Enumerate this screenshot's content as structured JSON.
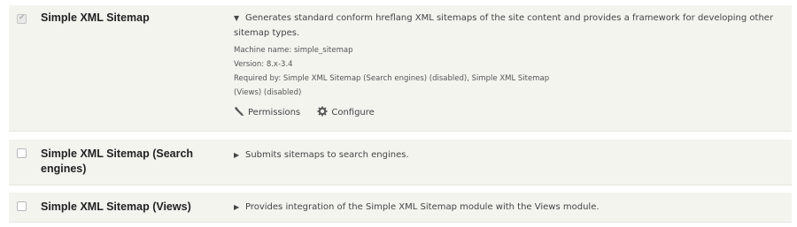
{
  "modules": [
    {
      "name": "Simple XML Sitemap",
      "checked": true,
      "expanded": true,
      "description": "Generates standard conform hreflang XML sitemaps of the site content and provides a framework for developing other sitemap types.",
      "machine_name": "Machine name: simple_sitemap",
      "version": "Version: 8.x-3.4",
      "required_by_1": "Required by: Simple XML Sitemap (Search engines) (disabled), Simple XML Sitemap",
      "required_by_2": "(Views) (disabled)",
      "links": {
        "permissions": "Permissions",
        "configure": "Configure"
      }
    },
    {
      "name": "Simple XML Sitemap (Search engines)",
      "checked": false,
      "expanded": false,
      "description": "Submits sitemaps to search engines."
    },
    {
      "name": "Simple XML Sitemap (Views)",
      "checked": false,
      "expanded": false,
      "description": "Provides integration of the Simple XML Sitemap module with the Views module."
    }
  ],
  "icons": {
    "expanded": "triangle-down-icon",
    "collapsed": "triangle-right-icon",
    "permissions": "wrench-icon",
    "configure": "gear-icon"
  }
}
